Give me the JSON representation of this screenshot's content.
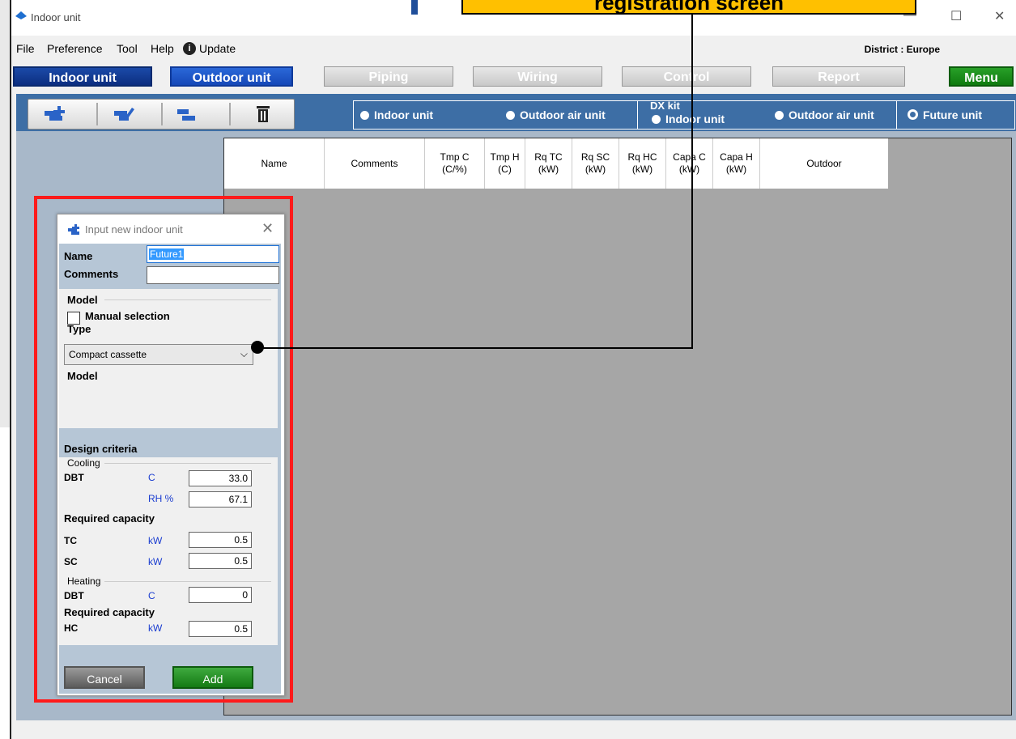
{
  "window": {
    "title": "Indoor unit"
  },
  "menu": {
    "items": [
      "File",
      "Preference",
      "Tool",
      "Help",
      "Update"
    ],
    "district": "District : Europe"
  },
  "nav": {
    "indoor": "Indoor unit",
    "outdoor": "Outdoor unit",
    "piping": "Piping",
    "wiring": "Wiring",
    "control": "Control",
    "report": "Report",
    "menu": "Menu"
  },
  "radios": {
    "group_label": "DX kit",
    "items": [
      "Indoor unit",
      "Outdoor air unit",
      "Indoor unit",
      "Outdoor air unit",
      "Future unit"
    ],
    "selected": "Future unit"
  },
  "grid": {
    "columns": [
      "Name",
      "Comments",
      "Tmp C\n(C/%)",
      "Tmp H\n(C)",
      "Rq TC\n(kW)",
      "Rq SC\n(kW)",
      "Rq HC\n(kW)",
      "Capa C\n(kW)",
      "Capa H\n(kW)",
      "Outdoor"
    ]
  },
  "dialog": {
    "title": "Input new indoor unit",
    "name_label": "Name",
    "name_value": "Future1",
    "comments_label": "Comments",
    "comments_value": "",
    "model_section": "Model",
    "manual_selection": "Manual selection",
    "type_label": "Type",
    "type_value": "Compact cassette",
    "model_label": "Model",
    "design_criteria": "Design criteria",
    "cooling": "Cooling",
    "dbt": "DBT",
    "unit_c": "C",
    "cooling_dbt": "33.0",
    "unit_rh": "RH %",
    "cooling_rh": "67.1",
    "required_capacity": "Required capacity",
    "tc": "TC",
    "unit_kw": "kW",
    "tc_value": "0.5",
    "sc": "SC",
    "sc_value": "0.5",
    "heating": "Heating",
    "heating_dbt": "0",
    "hc": "HC",
    "hc_value": "0.5",
    "cancel": "Cancel",
    "add": "Add"
  },
  "annotation": {
    "callout": "registration screen"
  },
  "colors": {
    "toolbar": "#3d6ea5",
    "grid_bg": "#a6a6a6",
    "highlight": "#ff1a1a",
    "callout": "#ffc000"
  }
}
